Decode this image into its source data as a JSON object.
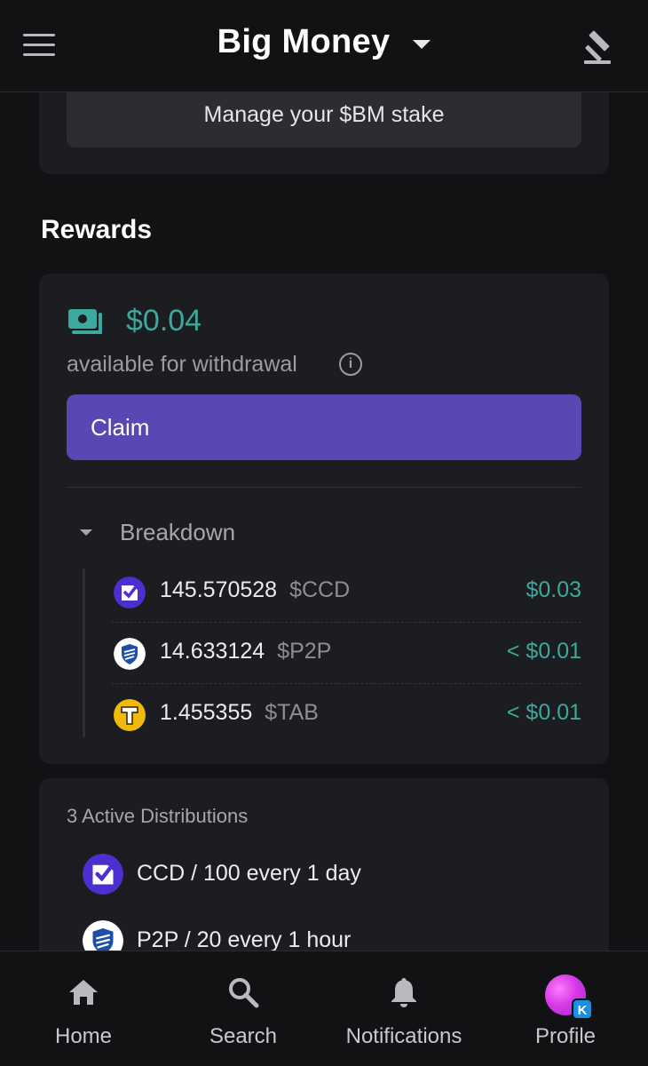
{
  "header": {
    "title": "Big Money",
    "menu_icon": "hamburger-menu-icon",
    "caret_icon": "caret-down-icon",
    "action_icon": "gavel-icon"
  },
  "stake": {
    "button_label": "Manage your $BM stake"
  },
  "rewards": {
    "section_title": "Rewards",
    "available_amount": "$0.04",
    "available_label": "available for withdrawal",
    "info_icon": "info-icon",
    "claim_label": "Claim",
    "breakdown_label": "Breakdown",
    "breakdown": [
      {
        "amount": "145.570528",
        "symbol": "$CCD",
        "value": "$0.03",
        "icon": "ccd-token-icon",
        "color": "#4d2fd0"
      },
      {
        "amount": "14.633124",
        "symbol": "$P2P",
        "value": "< $0.01",
        "icon": "p2p-token-icon",
        "color": "#1d4fa8"
      },
      {
        "amount": "1.455355",
        "symbol": "$TAB",
        "value": "< $0.01",
        "icon": "tab-token-icon",
        "color": "#f2b90d"
      }
    ]
  },
  "distributions": {
    "title": "3 Active Distributions",
    "items": [
      {
        "text": "CCD / 100 every 1 day",
        "icon": "ccd-token-icon"
      },
      {
        "text": "P2P / 20 every 1 hour",
        "icon": "p2p-token-icon"
      }
    ]
  },
  "nav": {
    "items": [
      {
        "label": "Home",
        "icon": "home-icon"
      },
      {
        "label": "Search",
        "icon": "search-icon"
      },
      {
        "label": "Notifications",
        "icon": "bell-icon"
      },
      {
        "label": "Profile",
        "icon": "avatar",
        "badge": "K"
      }
    ]
  },
  "colors": {
    "accent_green": "#3ba99c",
    "claim_purple": "#5a47b3",
    "background": "#111214",
    "card": "#1c1d20"
  }
}
